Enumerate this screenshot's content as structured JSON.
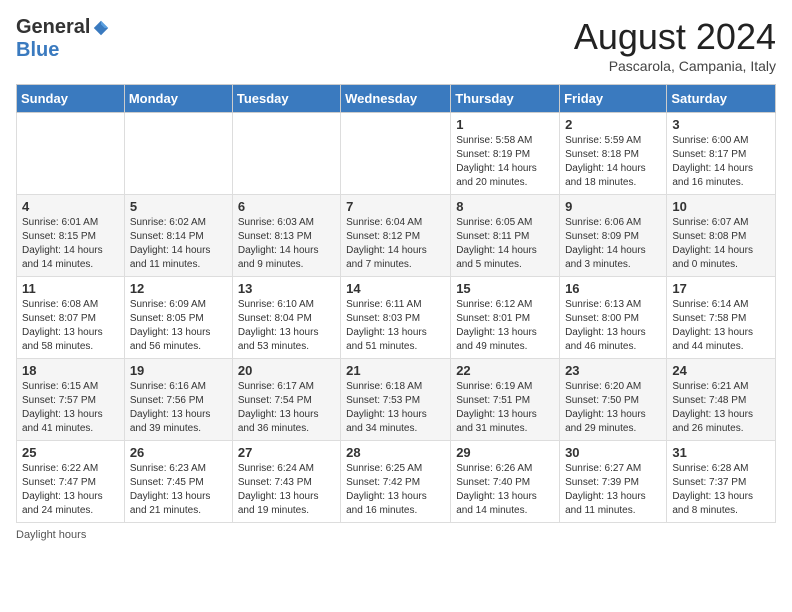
{
  "header": {
    "logo_general": "General",
    "logo_blue": "Blue",
    "month_year": "August 2024",
    "location": "Pascarola, Campania, Italy"
  },
  "days_of_week": [
    "Sunday",
    "Monday",
    "Tuesday",
    "Wednesday",
    "Thursday",
    "Friday",
    "Saturday"
  ],
  "weeks": [
    [
      {
        "day": "",
        "info": ""
      },
      {
        "day": "",
        "info": ""
      },
      {
        "day": "",
        "info": ""
      },
      {
        "day": "",
        "info": ""
      },
      {
        "day": "1",
        "info": "Sunrise: 5:58 AM\nSunset: 8:19 PM\nDaylight: 14 hours and 20 minutes."
      },
      {
        "day": "2",
        "info": "Sunrise: 5:59 AM\nSunset: 8:18 PM\nDaylight: 14 hours and 18 minutes."
      },
      {
        "day": "3",
        "info": "Sunrise: 6:00 AM\nSunset: 8:17 PM\nDaylight: 14 hours and 16 minutes."
      }
    ],
    [
      {
        "day": "4",
        "info": "Sunrise: 6:01 AM\nSunset: 8:15 PM\nDaylight: 14 hours and 14 minutes."
      },
      {
        "day": "5",
        "info": "Sunrise: 6:02 AM\nSunset: 8:14 PM\nDaylight: 14 hours and 11 minutes."
      },
      {
        "day": "6",
        "info": "Sunrise: 6:03 AM\nSunset: 8:13 PM\nDaylight: 14 hours and 9 minutes."
      },
      {
        "day": "7",
        "info": "Sunrise: 6:04 AM\nSunset: 8:12 PM\nDaylight: 14 hours and 7 minutes."
      },
      {
        "day": "8",
        "info": "Sunrise: 6:05 AM\nSunset: 8:11 PM\nDaylight: 14 hours and 5 minutes."
      },
      {
        "day": "9",
        "info": "Sunrise: 6:06 AM\nSunset: 8:09 PM\nDaylight: 14 hours and 3 minutes."
      },
      {
        "day": "10",
        "info": "Sunrise: 6:07 AM\nSunset: 8:08 PM\nDaylight: 14 hours and 0 minutes."
      }
    ],
    [
      {
        "day": "11",
        "info": "Sunrise: 6:08 AM\nSunset: 8:07 PM\nDaylight: 13 hours and 58 minutes."
      },
      {
        "day": "12",
        "info": "Sunrise: 6:09 AM\nSunset: 8:05 PM\nDaylight: 13 hours and 56 minutes."
      },
      {
        "day": "13",
        "info": "Sunrise: 6:10 AM\nSunset: 8:04 PM\nDaylight: 13 hours and 53 minutes."
      },
      {
        "day": "14",
        "info": "Sunrise: 6:11 AM\nSunset: 8:03 PM\nDaylight: 13 hours and 51 minutes."
      },
      {
        "day": "15",
        "info": "Sunrise: 6:12 AM\nSunset: 8:01 PM\nDaylight: 13 hours and 49 minutes."
      },
      {
        "day": "16",
        "info": "Sunrise: 6:13 AM\nSunset: 8:00 PM\nDaylight: 13 hours and 46 minutes."
      },
      {
        "day": "17",
        "info": "Sunrise: 6:14 AM\nSunset: 7:58 PM\nDaylight: 13 hours and 44 minutes."
      }
    ],
    [
      {
        "day": "18",
        "info": "Sunrise: 6:15 AM\nSunset: 7:57 PM\nDaylight: 13 hours and 41 minutes."
      },
      {
        "day": "19",
        "info": "Sunrise: 6:16 AM\nSunset: 7:56 PM\nDaylight: 13 hours and 39 minutes."
      },
      {
        "day": "20",
        "info": "Sunrise: 6:17 AM\nSunset: 7:54 PM\nDaylight: 13 hours and 36 minutes."
      },
      {
        "day": "21",
        "info": "Sunrise: 6:18 AM\nSunset: 7:53 PM\nDaylight: 13 hours and 34 minutes."
      },
      {
        "day": "22",
        "info": "Sunrise: 6:19 AM\nSunset: 7:51 PM\nDaylight: 13 hours and 31 minutes."
      },
      {
        "day": "23",
        "info": "Sunrise: 6:20 AM\nSunset: 7:50 PM\nDaylight: 13 hours and 29 minutes."
      },
      {
        "day": "24",
        "info": "Sunrise: 6:21 AM\nSunset: 7:48 PM\nDaylight: 13 hours and 26 minutes."
      }
    ],
    [
      {
        "day": "25",
        "info": "Sunrise: 6:22 AM\nSunset: 7:47 PM\nDaylight: 13 hours and 24 minutes."
      },
      {
        "day": "26",
        "info": "Sunrise: 6:23 AM\nSunset: 7:45 PM\nDaylight: 13 hours and 21 minutes."
      },
      {
        "day": "27",
        "info": "Sunrise: 6:24 AM\nSunset: 7:43 PM\nDaylight: 13 hours and 19 minutes."
      },
      {
        "day": "28",
        "info": "Sunrise: 6:25 AM\nSunset: 7:42 PM\nDaylight: 13 hours and 16 minutes."
      },
      {
        "day": "29",
        "info": "Sunrise: 6:26 AM\nSunset: 7:40 PM\nDaylight: 13 hours and 14 minutes."
      },
      {
        "day": "30",
        "info": "Sunrise: 6:27 AM\nSunset: 7:39 PM\nDaylight: 13 hours and 11 minutes."
      },
      {
        "day": "31",
        "info": "Sunrise: 6:28 AM\nSunset: 7:37 PM\nDaylight: 13 hours and 8 minutes."
      }
    ]
  ],
  "footer": {
    "note": "Daylight hours"
  }
}
